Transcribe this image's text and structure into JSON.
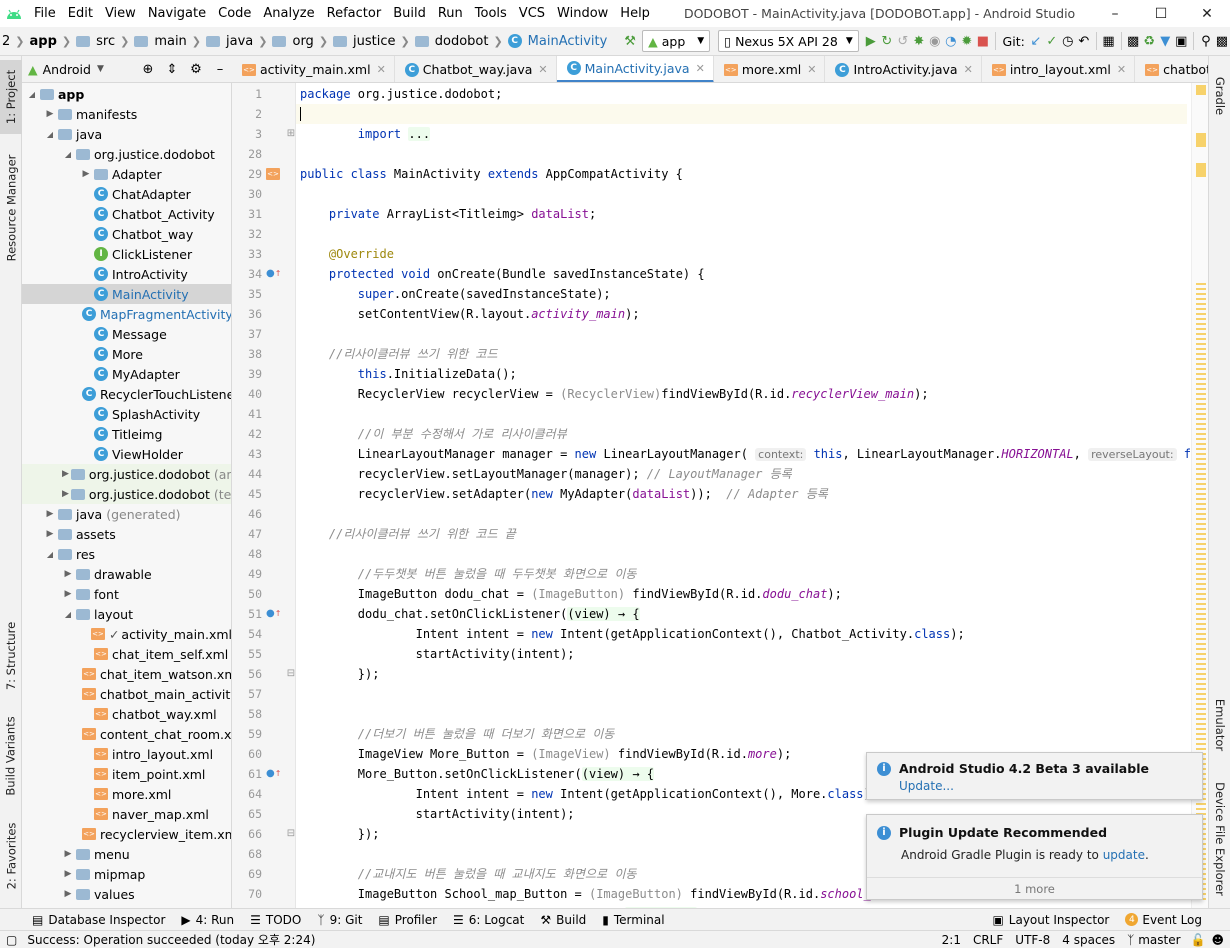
{
  "window": {
    "menus": [
      "File",
      "Edit",
      "View",
      "Navigate",
      "Code",
      "Analyze",
      "Refactor",
      "Build",
      "Run",
      "Tools",
      "VCS",
      "Window",
      "Help"
    ],
    "title": "DODOBOT - MainActivity.java [DODOBOT.app] - Android Studio"
  },
  "breadcrumb": [
    "2",
    "app",
    "src",
    "main",
    "java",
    "org",
    "justice",
    "dodobot",
    "MainActivity"
  ],
  "toolbar": {
    "run_config": "app",
    "device": "Nexus 5X API 28",
    "git_label": "Git:"
  },
  "left_tabs": [
    "1: Project",
    "Resource Manager",
    "7: Structure",
    "Build Variants",
    "2: Favorites"
  ],
  "right_tabs": [
    "Gradle",
    "Emulator",
    "Device File Explorer"
  ],
  "project": {
    "view": "Android",
    "tree": [
      {
        "label": "app",
        "suffix": "",
        "depth": 0,
        "type": "folder",
        "open": true,
        "bold": true
      },
      {
        "label": "manifests",
        "suffix": "",
        "depth": 1,
        "type": "folder",
        "open": false
      },
      {
        "label": "java",
        "suffix": "",
        "depth": 1,
        "type": "folder",
        "open": true
      },
      {
        "label": "org.justice.dodobot",
        "suffix": "",
        "depth": 2,
        "type": "folder",
        "open": true
      },
      {
        "label": "Adapter",
        "suffix": "",
        "depth": 3,
        "type": "folder",
        "open": false
      },
      {
        "label": "ChatAdapter",
        "suffix": "",
        "depth": 3,
        "type": "class"
      },
      {
        "label": "Chatbot_Activity",
        "suffix": "",
        "depth": 3,
        "type": "class"
      },
      {
        "label": "Chatbot_way",
        "suffix": "",
        "depth": 3,
        "type": "class"
      },
      {
        "label": "ClickListener",
        "suffix": "",
        "depth": 3,
        "type": "iface"
      },
      {
        "label": "IntroActivity",
        "suffix": "",
        "depth": 3,
        "type": "class"
      },
      {
        "label": "MainActivity",
        "suffix": "",
        "depth": 3,
        "type": "class",
        "selected": true
      },
      {
        "label": "MapFragmentActivity",
        "suffix": "",
        "depth": 3,
        "type": "class"
      },
      {
        "label": "Message",
        "suffix": "",
        "depth": 3,
        "type": "class"
      },
      {
        "label": "More",
        "suffix": "",
        "depth": 3,
        "type": "class"
      },
      {
        "label": "MyAdapter",
        "suffix": "",
        "depth": 3,
        "type": "class"
      },
      {
        "label": "RecyclerTouchListener",
        "suffix": "",
        "depth": 3,
        "type": "class"
      },
      {
        "label": "SplashActivity",
        "suffix": "",
        "depth": 3,
        "type": "class"
      },
      {
        "label": "Titleimg",
        "suffix": "",
        "depth": 3,
        "type": "class"
      },
      {
        "label": "ViewHolder",
        "suffix": "",
        "depth": 3,
        "type": "class"
      },
      {
        "label": "org.justice.dodobot",
        "suffix": "(andr",
        "depth": 2,
        "type": "folder",
        "open": false,
        "hl": true
      },
      {
        "label": "org.justice.dodobot",
        "suffix": "(test)",
        "depth": 2,
        "type": "folder",
        "open": false,
        "hl": true
      },
      {
        "label": "java",
        "suffix": "(generated)",
        "depth": 1,
        "type": "folder",
        "open": false
      },
      {
        "label": "assets",
        "suffix": "",
        "depth": 1,
        "type": "folder",
        "open": false
      },
      {
        "label": "res",
        "suffix": "",
        "depth": 1,
        "type": "folder",
        "open": true
      },
      {
        "label": "drawable",
        "suffix": "",
        "depth": 2,
        "type": "folder",
        "open": false
      },
      {
        "label": "font",
        "suffix": "",
        "depth": 2,
        "type": "folder",
        "open": false
      },
      {
        "label": "layout",
        "suffix": "",
        "depth": 2,
        "type": "folder",
        "open": true
      },
      {
        "label": "activity_main.xml",
        "suffix": "",
        "depth": 3,
        "type": "xml",
        "check": true
      },
      {
        "label": "chat_item_self.xml",
        "suffix": "",
        "depth": 3,
        "type": "xml"
      },
      {
        "label": "chat_item_watson.xm",
        "suffix": "",
        "depth": 3,
        "type": "xml"
      },
      {
        "label": "chatbot_main_activity",
        "suffix": "",
        "depth": 3,
        "type": "xml"
      },
      {
        "label": "chatbot_way.xml",
        "suffix": "",
        "depth": 3,
        "type": "xml"
      },
      {
        "label": "content_chat_room.xr",
        "suffix": "",
        "depth": 3,
        "type": "xml"
      },
      {
        "label": "intro_layout.xml",
        "suffix": "",
        "depth": 3,
        "type": "xml"
      },
      {
        "label": "item_point.xml",
        "suffix": "",
        "depth": 3,
        "type": "xml"
      },
      {
        "label": "more.xml",
        "suffix": "",
        "depth": 3,
        "type": "xml"
      },
      {
        "label": "naver_map.xml",
        "suffix": "",
        "depth": 3,
        "type": "xml"
      },
      {
        "label": "recyclerview_item.xml",
        "suffix": "",
        "depth": 3,
        "type": "xml"
      },
      {
        "label": "menu",
        "suffix": "",
        "depth": 2,
        "type": "folder",
        "open": false
      },
      {
        "label": "mipmap",
        "suffix": "",
        "depth": 2,
        "type": "folder",
        "open": false
      },
      {
        "label": "values",
        "suffix": "",
        "depth": 2,
        "type": "folder",
        "open": false
      }
    ]
  },
  "tabs": [
    {
      "label": "activity_main.xml",
      "type": "xml"
    },
    {
      "label": "Chatbot_way.java",
      "type": "class"
    },
    {
      "label": "MainActivity.java",
      "type": "class",
      "active": true
    },
    {
      "label": "more.xml",
      "type": "xml"
    },
    {
      "label": "IntroActivity.java",
      "type": "class"
    },
    {
      "label": "intro_layout.xml",
      "type": "xml"
    },
    {
      "label": "chatbot_way.xml",
      "type": "xml"
    }
  ],
  "code_lines": [
    {
      "n": "1",
      "g": "",
      "segs": [
        [
          "kw",
          "package "
        ],
        [
          "",
          "org.justice.dodobot;"
        ]
      ]
    },
    {
      "n": "2",
      "g": "",
      "cur": true,
      "segs": [
        [
          "",
          ""
        ]
      ]
    },
    {
      "n": "3",
      "g": "+",
      "segs": [
        [
          "",
          "        "
        ],
        [
          "kw",
          "import "
        ],
        [
          "lam",
          "..."
        ]
      ]
    },
    {
      "n": "28",
      "g": "",
      "segs": [
        [
          "",
          ""
        ]
      ]
    },
    {
      "n": "29",
      "g": "xml",
      "segs": [
        [
          "kw",
          "public class "
        ],
        [
          "",
          "MainActivity "
        ],
        [
          "kw",
          "extends "
        ],
        [
          "",
          "AppCompatActivity {"
        ]
      ]
    },
    {
      "n": "30",
      "g": "",
      "segs": [
        [
          "",
          ""
        ]
      ]
    },
    {
      "n": "31",
      "g": "",
      "segs": [
        [
          "",
          "    "
        ],
        [
          "kw",
          "private "
        ],
        [
          "",
          "ArrayList<Titleimg> "
        ],
        [
          "fldn",
          "dataList"
        ],
        [
          "",
          ";"
        ]
      ]
    },
    {
      "n": "32",
      "g": "",
      "segs": [
        [
          "",
          ""
        ]
      ]
    },
    {
      "n": "33",
      "g": "",
      "segs": [
        [
          "",
          "    "
        ],
        [
          "an",
          "@Override"
        ]
      ]
    },
    {
      "n": "34",
      "g": "o",
      "segs": [
        [
          "",
          "    "
        ],
        [
          "kw",
          "protected void "
        ],
        [
          "",
          "onCreate(Bundle savedInstanceState) {"
        ]
      ]
    },
    {
      "n": "35",
      "g": "",
      "segs": [
        [
          "",
          "        "
        ],
        [
          "kw",
          "super"
        ],
        [
          "",
          ".onCreate(savedInstanceState);"
        ]
      ]
    },
    {
      "n": "36",
      "g": "",
      "segs": [
        [
          "",
          "        setContentView(R.layout."
        ],
        [
          "fld",
          "activity_main"
        ],
        [
          "",
          ");"
        ]
      ]
    },
    {
      "n": "37",
      "g": "",
      "segs": [
        [
          "",
          ""
        ]
      ]
    },
    {
      "n": "38",
      "g": "",
      "segs": [
        [
          "",
          "    "
        ],
        [
          "cm",
          "//리사이클러뷰 쓰기 위한 코드"
        ]
      ]
    },
    {
      "n": "39",
      "g": "",
      "segs": [
        [
          "",
          "        "
        ],
        [
          "kw",
          "this"
        ],
        [
          "",
          ".InitializeData();"
        ]
      ]
    },
    {
      "n": "40",
      "g": "",
      "segs": [
        [
          "",
          "        RecyclerView recyclerView = "
        ],
        [
          "gray",
          "(RecyclerView)"
        ],
        [
          "",
          "findViewById(R.id."
        ],
        [
          "fld",
          "recyclerView_main"
        ],
        [
          "",
          ");"
        ]
      ]
    },
    {
      "n": "41",
      "g": "",
      "segs": [
        [
          "",
          ""
        ]
      ]
    },
    {
      "n": "42",
      "g": "",
      "segs": [
        [
          "",
          "        "
        ],
        [
          "cm",
          "//이 부분 수정해서 가로 리사이클러뷰"
        ]
      ]
    },
    {
      "n": "43",
      "g": "",
      "segs": [
        [
          "",
          "        LinearLayoutManager manager = "
        ],
        [
          "kw",
          "new "
        ],
        [
          "",
          "LinearLayoutManager( "
        ],
        [
          "hint",
          "context:"
        ],
        [
          "kw",
          " this"
        ],
        [
          "",
          ", LinearLayoutManager."
        ],
        [
          "fld",
          "HORIZONTAL"
        ],
        [
          "",
          ", "
        ],
        [
          "hint",
          "reverseLayout:"
        ],
        [
          "kw",
          " false"
        ],
        [
          "",
          ");"
        ]
      ]
    },
    {
      "n": "44",
      "g": "",
      "segs": [
        [
          "",
          "        recyclerView.setLayoutManager(manager); "
        ],
        [
          "cm",
          "// LayoutManager 등록"
        ]
      ]
    },
    {
      "n": "45",
      "g": "",
      "segs": [
        [
          "",
          "        recyclerView.setAdapter("
        ],
        [
          "kw",
          "new "
        ],
        [
          "",
          "MyAdapter("
        ],
        [
          "fldn",
          "dataList"
        ],
        [
          "",
          "));  "
        ],
        [
          "cm",
          "// Adapter 등록"
        ]
      ]
    },
    {
      "n": "46",
      "g": "",
      "segs": [
        [
          "",
          ""
        ]
      ]
    },
    {
      "n": "47",
      "g": "",
      "segs": [
        [
          "",
          "    "
        ],
        [
          "cm",
          "//리사이클러뷰 쓰기 위한 코드 끝"
        ]
      ]
    },
    {
      "n": "48",
      "g": "",
      "segs": [
        [
          "",
          ""
        ]
      ]
    },
    {
      "n": "49",
      "g": "",
      "segs": [
        [
          "",
          "        "
        ],
        [
          "cm",
          "//두두챗봇 버튼 눌렀을 때 두두챗봇 화면으로 이동"
        ]
      ]
    },
    {
      "n": "50",
      "g": "",
      "segs": [
        [
          "",
          "        ImageButton dodu_chat = "
        ],
        [
          "gray",
          "(ImageButton) "
        ],
        [
          "",
          "findViewById(R.id."
        ],
        [
          "fld",
          "dodu_chat"
        ],
        [
          "",
          ");"
        ]
      ]
    },
    {
      "n": "51",
      "g": "o",
      "segs": [
        [
          "",
          "        dodu_chat.setOnClickListener("
        ],
        [
          "lam",
          "(view) → {"
        ]
      ]
    },
    {
      "n": "54",
      "g": "",
      "segs": [
        [
          "",
          "                Intent intent = "
        ],
        [
          "kw",
          "new "
        ],
        [
          "",
          "Intent(getApplicationContext(), Chatbot_Activity."
        ],
        [
          "kw",
          "class"
        ],
        [
          "",
          ");"
        ]
      ]
    },
    {
      "n": "55",
      "g": "",
      "segs": [
        [
          "",
          "                startActivity(intent);"
        ]
      ]
    },
    {
      "n": "56",
      "g": "-",
      "segs": [
        [
          "",
          "        });"
        ]
      ]
    },
    {
      "n": "57",
      "g": "",
      "segs": [
        [
          "",
          ""
        ]
      ]
    },
    {
      "n": "58",
      "g": "",
      "segs": [
        [
          "",
          ""
        ]
      ]
    },
    {
      "n": "59",
      "g": "",
      "segs": [
        [
          "",
          "        "
        ],
        [
          "cm",
          "//더보기 버튼 눌렀을 때 더보기 화면으로 이동"
        ]
      ]
    },
    {
      "n": "60",
      "g": "",
      "segs": [
        [
          "",
          "        ImageView More_Button = "
        ],
        [
          "gray",
          "(ImageView) "
        ],
        [
          "",
          "findViewById(R.id."
        ],
        [
          "fld",
          "more"
        ],
        [
          "",
          ");"
        ]
      ]
    },
    {
      "n": "61",
      "g": "o",
      "segs": [
        [
          "",
          "        More_Button.setOnClickListener("
        ],
        [
          "lam",
          "(view) → {"
        ]
      ]
    },
    {
      "n": "64",
      "g": "",
      "segs": [
        [
          "",
          "                Intent intent = "
        ],
        [
          "kw",
          "new "
        ],
        [
          "",
          "Intent(getApplicationContext(), More."
        ],
        [
          "kw",
          "class"
        ],
        [
          "",
          ");"
        ]
      ]
    },
    {
      "n": "65",
      "g": "",
      "segs": [
        [
          "",
          "                startActivity(intent);"
        ]
      ]
    },
    {
      "n": "66",
      "g": "-",
      "segs": [
        [
          "",
          "        });"
        ]
      ]
    },
    {
      "n": "68",
      "g": "",
      "segs": [
        [
          "",
          ""
        ]
      ]
    },
    {
      "n": "69",
      "g": "",
      "segs": [
        [
          "",
          "        "
        ],
        [
          "cm",
          "//교내지도 버튼 눌렀을 때 교내지도 화면으로 이동"
        ]
      ]
    },
    {
      "n": "70",
      "g": "",
      "segs": [
        [
          "",
          "        ImageButton School_map_Button = "
        ],
        [
          "gray",
          "(ImageButton) "
        ],
        [
          "",
          "findViewById(R.id."
        ],
        [
          "fld",
          "school_ma"
        ]
      ]
    },
    {
      "n": "71",
      "g": "o",
      "segs": [
        [
          "",
          "        School_map_Button.setOnClickListener("
        ],
        [
          "lam",
          "(view) → {"
        ]
      ]
    }
  ],
  "notifications": [
    {
      "title": "Android Studio 4.2 Beta 3 available",
      "link": "Update..."
    },
    {
      "title": "Plugin Update Recommended",
      "body": "Android Gradle Plugin is ready to ",
      "link": "update",
      "tail": ".",
      "more": "1 more"
    }
  ],
  "bottom_tools": [
    "Database Inspector",
    "4: Run",
    "TODO",
    "9: Git",
    "Profiler",
    "6: Logcat",
    "Build",
    "Terminal"
  ],
  "bottom_right_tools": [
    "Layout Inspector",
    "Event Log"
  ],
  "event_count": "4",
  "status": {
    "message": "Success: Operation succeeded (today 오후 2:24)",
    "position": "2:1",
    "line_sep": "CRLF",
    "encoding": "UTF-8",
    "indent": "4 spaces",
    "branch": "master"
  },
  "colors": {
    "accent": "#4083c9",
    "class_icon": "#3d9ed8",
    "xml_icon": "#f3a25c",
    "keyword": "#0033b3"
  }
}
